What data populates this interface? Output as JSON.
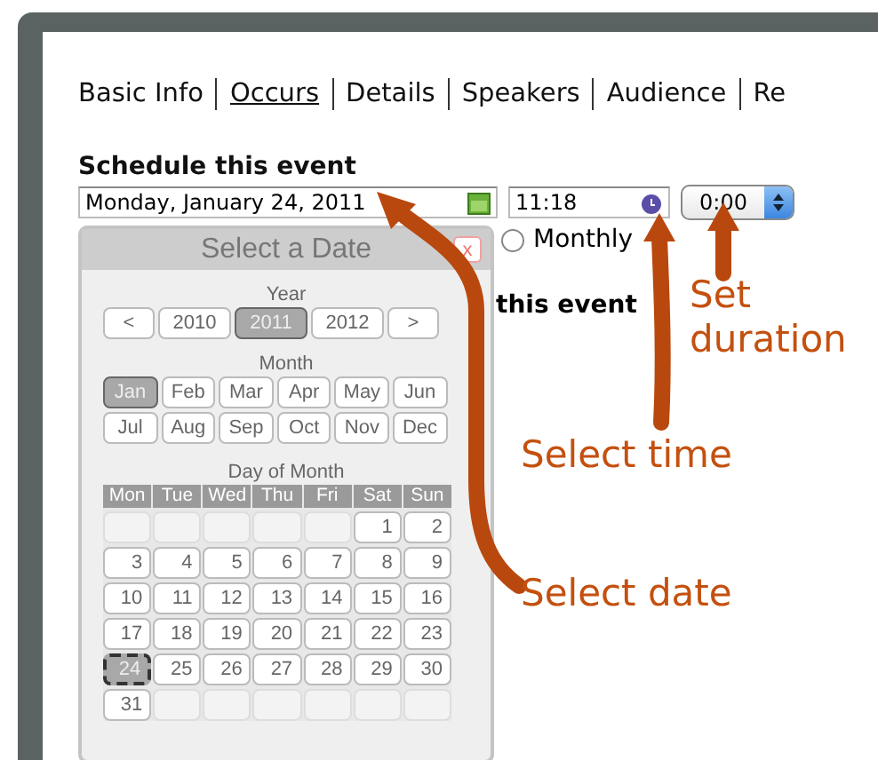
{
  "tabs": [
    {
      "label": "Basic Info",
      "selected": false
    },
    {
      "label": "Occurs",
      "selected": true
    },
    {
      "label": "Details",
      "selected": false
    },
    {
      "label": "Speakers",
      "selected": false
    },
    {
      "label": "Audience",
      "selected": false
    },
    {
      "label": "Re",
      "selected": false
    }
  ],
  "section_title": "Schedule this event",
  "date_field": {
    "value": "Monday, January 24, 2011"
  },
  "time_field": {
    "value": "11:18"
  },
  "duration_select": {
    "value": "0:00"
  },
  "recurrence_radio": {
    "label": "Monthly",
    "selected": false
  },
  "partial_heading": "this event",
  "date_picker": {
    "title": "Select a Date",
    "close": "x",
    "year_label": "Year",
    "years": [
      {
        "label": "<",
        "selected": false
      },
      {
        "label": "2010",
        "selected": false
      },
      {
        "label": "2011",
        "selected": true
      },
      {
        "label": "2012",
        "selected": false
      },
      {
        "label": ">",
        "selected": false
      }
    ],
    "month_label": "Month",
    "months": [
      {
        "label": "Jan",
        "selected": true
      },
      {
        "label": "Feb",
        "selected": false
      },
      {
        "label": "Mar",
        "selected": false
      },
      {
        "label": "Apr",
        "selected": false
      },
      {
        "label": "May",
        "selected": false
      },
      {
        "label": "Jun",
        "selected": false
      },
      {
        "label": "Jul",
        "selected": false
      },
      {
        "label": "Aug",
        "selected": false
      },
      {
        "label": "Sep",
        "selected": false
      },
      {
        "label": "Oct",
        "selected": false
      },
      {
        "label": "Nov",
        "selected": false
      },
      {
        "label": "Dec",
        "selected": false
      }
    ],
    "day_label": "Day of Month",
    "weekdays": [
      "Mon",
      "Tue",
      "Wed",
      "Thu",
      "Fri",
      "Sat",
      "Sun"
    ],
    "weeks": [
      [
        {
          "kind": "blank"
        },
        {
          "kind": "blank"
        },
        {
          "kind": "blank"
        },
        {
          "kind": "blank"
        },
        {
          "kind": "blank"
        },
        {
          "kind": "day",
          "label": "1",
          "selected": false
        },
        {
          "kind": "day",
          "label": "2",
          "selected": false
        }
      ],
      [
        {
          "kind": "day",
          "label": "3",
          "selected": false
        },
        {
          "kind": "day",
          "label": "4",
          "selected": false
        },
        {
          "kind": "day",
          "label": "5",
          "selected": false
        },
        {
          "kind": "day",
          "label": "6",
          "selected": false
        },
        {
          "kind": "day",
          "label": "7",
          "selected": false
        },
        {
          "kind": "day",
          "label": "8",
          "selected": false
        },
        {
          "kind": "day",
          "label": "9",
          "selected": false
        }
      ],
      [
        {
          "kind": "day",
          "label": "10",
          "selected": false
        },
        {
          "kind": "day",
          "label": "11",
          "selected": false
        },
        {
          "kind": "day",
          "label": "12",
          "selected": false
        },
        {
          "kind": "day",
          "label": "13",
          "selected": false
        },
        {
          "kind": "day",
          "label": "14",
          "selected": false
        },
        {
          "kind": "day",
          "label": "15",
          "selected": false
        },
        {
          "kind": "day",
          "label": "16",
          "selected": false
        }
      ],
      [
        {
          "kind": "day",
          "label": "17",
          "selected": false
        },
        {
          "kind": "day",
          "label": "18",
          "selected": false
        },
        {
          "kind": "day",
          "label": "19",
          "selected": false
        },
        {
          "kind": "day",
          "label": "20",
          "selected": false
        },
        {
          "kind": "day",
          "label": "21",
          "selected": false
        },
        {
          "kind": "day",
          "label": "22",
          "selected": false
        },
        {
          "kind": "day",
          "label": "23",
          "selected": false
        }
      ],
      [
        {
          "kind": "day",
          "label": "24",
          "selected": true
        },
        {
          "kind": "day",
          "label": "25",
          "selected": false
        },
        {
          "kind": "day",
          "label": "26",
          "selected": false
        },
        {
          "kind": "day",
          "label": "27",
          "selected": false
        },
        {
          "kind": "day",
          "label": "28",
          "selected": false
        },
        {
          "kind": "day",
          "label": "29",
          "selected": false
        },
        {
          "kind": "day",
          "label": "30",
          "selected": false
        }
      ],
      [
        {
          "kind": "day",
          "label": "31",
          "selected": false
        },
        {
          "kind": "blank"
        },
        {
          "kind": "blank"
        },
        {
          "kind": "blank"
        },
        {
          "kind": "blank"
        },
        {
          "kind": "blank"
        },
        {
          "kind": "blank"
        }
      ]
    ]
  },
  "annotations": [
    {
      "text": "Set duration"
    },
    {
      "text": "Select time"
    },
    {
      "text": "Select date"
    }
  ]
}
